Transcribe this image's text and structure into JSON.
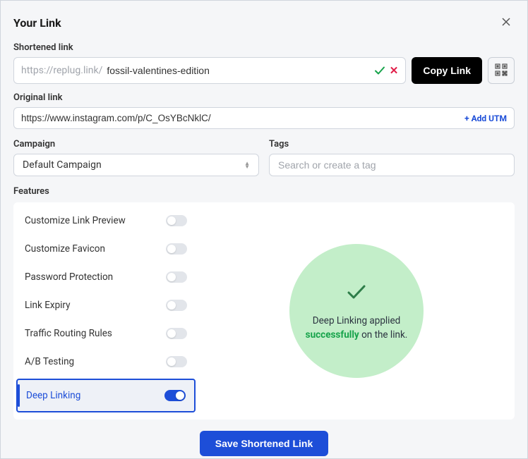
{
  "modal": {
    "title": "Your Link",
    "close_label": "Close"
  },
  "shortened": {
    "label": "Shortened link",
    "domain": "https://replug.link/",
    "slug": "fossil-valentines-edition",
    "copy_label": "Copy Link"
  },
  "original": {
    "label": "Original link",
    "url": "https://www.instagram.com/p/C_OsYBcNklC/",
    "add_utm_label": "+ Add UTM"
  },
  "campaign": {
    "label": "Campaign",
    "selected": "Default Campaign"
  },
  "tags": {
    "label": "Tags",
    "placeholder": "Search or create a tag"
  },
  "features": {
    "label": "Features",
    "items": [
      {
        "label": "Customize Link Preview",
        "on": false,
        "highlight": false
      },
      {
        "label": "Customize Favicon",
        "on": false,
        "highlight": false
      },
      {
        "label": "Password Protection",
        "on": false,
        "highlight": false
      },
      {
        "label": "Link Expiry",
        "on": false,
        "highlight": false
      },
      {
        "label": "Traffic Routing Rules",
        "on": false,
        "highlight": false
      },
      {
        "label": "A/B Testing",
        "on": false,
        "highlight": false
      },
      {
        "label": "Deep Linking",
        "on": true,
        "highlight": true
      }
    ],
    "success": {
      "pre": "Deep Linking applied",
      "word": "successfully",
      "post": "on the link."
    }
  },
  "save_label": "Save Shortened Link"
}
